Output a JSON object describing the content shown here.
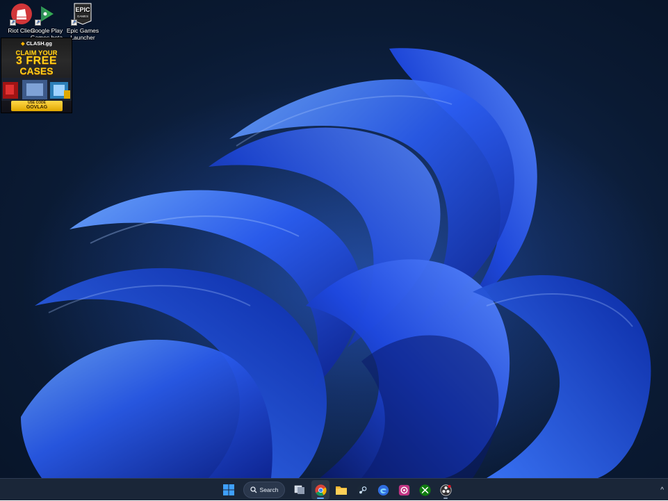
{
  "desktop": {
    "icons": [
      {
        "label": "Riot Client",
        "icon": "riot-client-icon",
        "color": "#d13639"
      },
      {
        "label": "Google Play Games beta",
        "icon": "google-play-games-icon",
        "color": "#34a853"
      },
      {
        "label": "Epic Games Launcher",
        "icon": "epic-games-icon",
        "color": "#2a2a2a"
      }
    ],
    "epic_logo_text": "EPIC",
    "epic_logo_sub": "GAMES"
  },
  "ad": {
    "brand": "CLASH.gg",
    "line1": "CLAIM YOUR",
    "line2": "3 FREE",
    "line3": "CASES",
    "code_label": "USE CODE",
    "code": "GOVLAG"
  },
  "taskbar": {
    "search_label": "Search",
    "apps": [
      {
        "name": "start-button",
        "icon": "windows-logo-icon"
      },
      {
        "name": "task-view-button",
        "icon": "task-view-icon"
      },
      {
        "name": "chrome-button",
        "icon": "chrome-icon"
      },
      {
        "name": "file-explorer-button",
        "icon": "folder-icon"
      },
      {
        "name": "steam-button",
        "icon": "steam-icon"
      },
      {
        "name": "edge-dev-button",
        "icon": "edge-icon"
      },
      {
        "name": "obs-button",
        "icon": "app-icon"
      },
      {
        "name": "xbox-button",
        "icon": "xbox-icon"
      },
      {
        "name": "obs-studio-button",
        "icon": "obs-icon"
      }
    ],
    "tray_chevron": "^"
  },
  "colors": {
    "accent": "#60a5ff",
    "taskbar_bg": "#1a2638",
    "wallpaper_blue": "#1f4fe0"
  }
}
